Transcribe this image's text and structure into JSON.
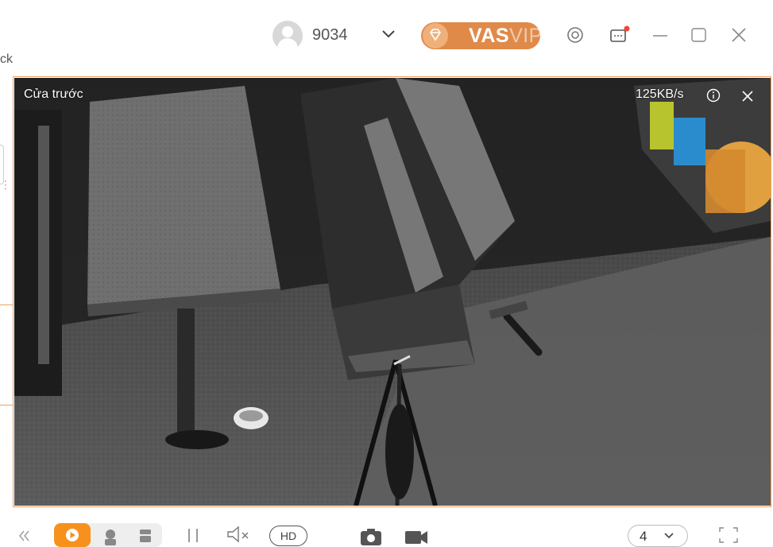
{
  "header": {
    "left_partial_text": "ck",
    "username": "9034",
    "vip_label": "VAS",
    "vip_label_ghost": "VIP"
  },
  "video": {
    "camera_name": "Cửa trước",
    "bitrate": "125KB/s"
  },
  "toolbar": {
    "hd_label": "HD",
    "layout_value": "4"
  },
  "icons": {
    "avatar": "user-avatar-icon",
    "dropdown": "chevron-down-icon",
    "vip_gem": "diamond-icon",
    "settings": "settings-icon",
    "messages": "message-icon",
    "minimize": "minimize-icon",
    "maximize": "maximize-icon",
    "close": "close-icon",
    "info": "info-icon",
    "close_video": "close-video-icon",
    "collapse": "double-chevron-left-icon",
    "playback": "play-icon",
    "camera_mode": "camera-mode-icon",
    "storage_mode": "storage-mode-icon",
    "pause": "pause-icon",
    "mute": "speaker-mute-icon",
    "snapshot": "snapshot-icon",
    "record": "record-video-icon",
    "fullscreen": "fullscreen-icon"
  },
  "colors": {
    "accent": "#f7911e",
    "vip": "#e08a4a",
    "frame_border": "#f0a060"
  }
}
